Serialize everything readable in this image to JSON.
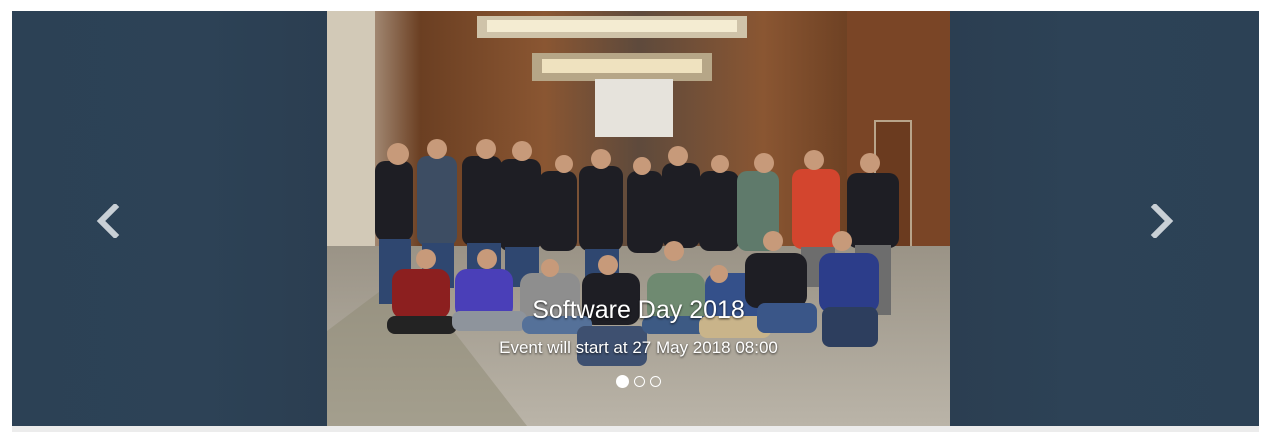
{
  "carousel": {
    "title": "Software Day 2018",
    "subtitle": "Event will start at 27 May 2018 08:00",
    "indicators": [
      {
        "label": "slide-1",
        "active": true
      },
      {
        "label": "slide-2",
        "active": false
      },
      {
        "label": "slide-3",
        "active": false
      }
    ],
    "prev_icon": "chevron-left-icon",
    "next_icon": "chevron-right-icon",
    "image_alt": "group-photo"
  },
  "colors": {
    "panel_bg": "#2c4155",
    "control": "#c9d0d6",
    "caption_text": "#ffffff"
  }
}
